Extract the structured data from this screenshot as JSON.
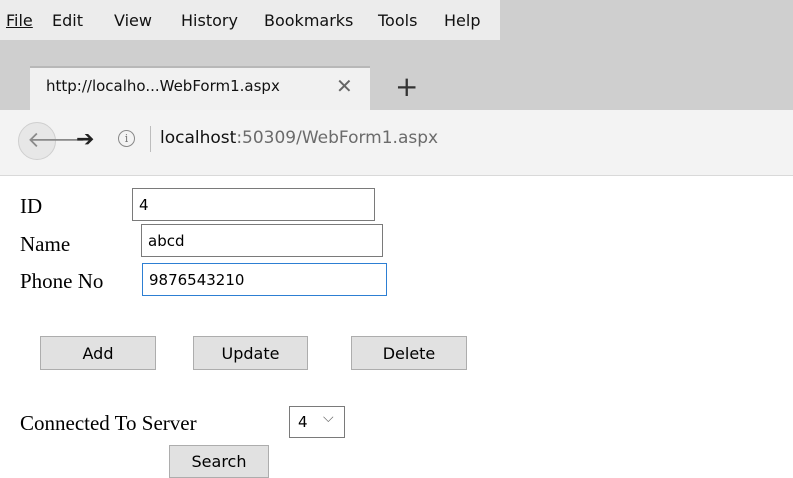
{
  "browser": {
    "menu": [
      "File",
      "Edit",
      "View",
      "History",
      "Bookmarks",
      "Tools",
      "Help"
    ],
    "tab": {
      "title": "http://localho...WebForm1.aspx",
      "close_icon": "close-icon",
      "new_tab_icon": "plus-icon"
    },
    "nav": {
      "back_icon": "back-arrow-icon",
      "forward_icon": "forward-arrow-icon",
      "info_icon": "info-icon",
      "url_host": "localhost",
      "url_rest": ":50309/WebForm1.aspx"
    }
  },
  "form": {
    "id_label": "ID",
    "id_value": "4",
    "name_label": "Name",
    "name_value": "abcd",
    "phone_label": "Phone No",
    "phone_value": "9876543210",
    "add_label": "Add",
    "update_label": "Update",
    "delete_label": "Delete",
    "server_label": "Connected To Server",
    "server_selected": "4",
    "search_label": "Search"
  }
}
